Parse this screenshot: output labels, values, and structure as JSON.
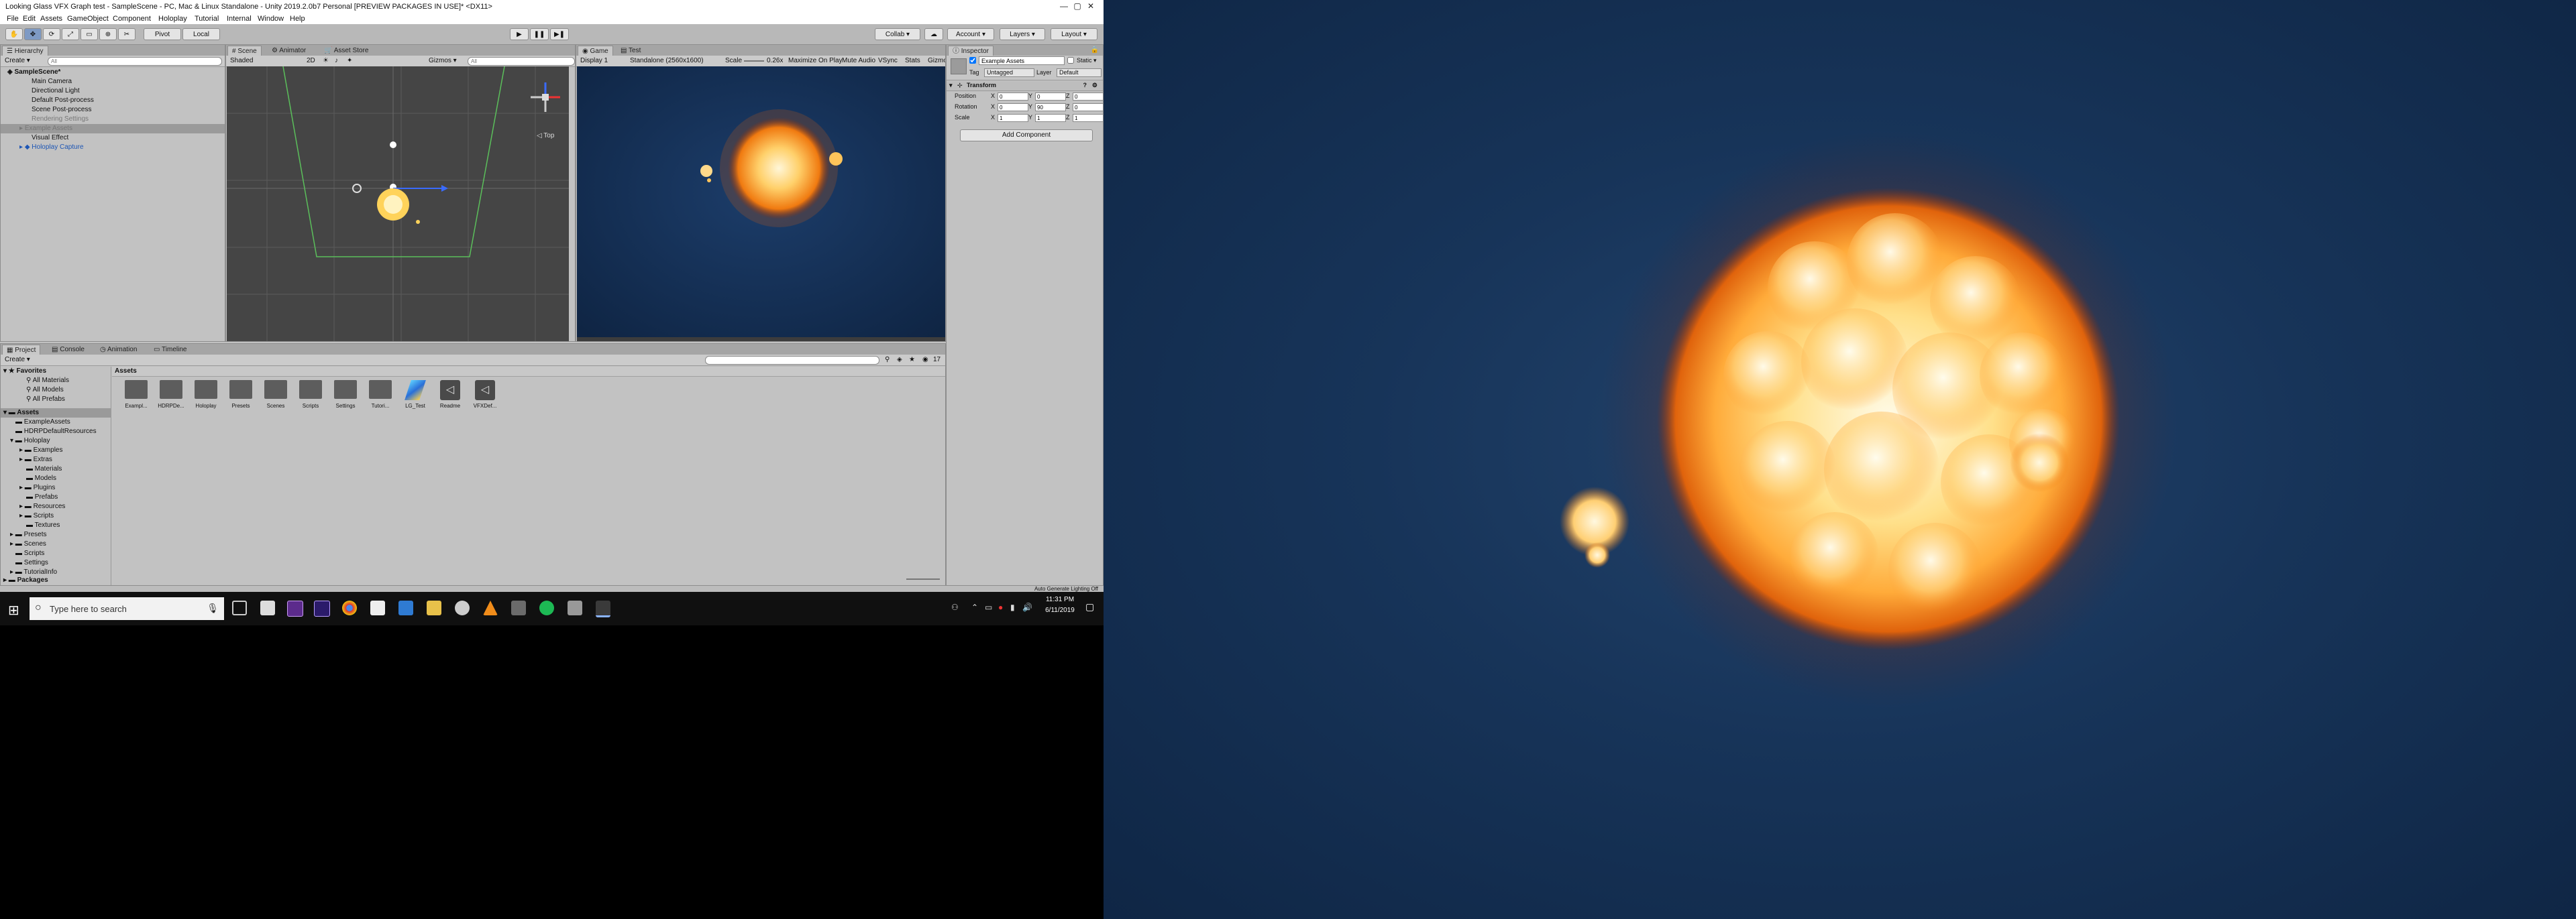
{
  "window": {
    "title": "Looking Glass VFX Graph test - SampleScene - PC, Mac & Linux Standalone - Unity 2019.2.0b7 Personal [PREVIEW PACKAGES IN USE]* <DX11>",
    "minimize": "—",
    "maximize": "▢",
    "close": "✕"
  },
  "menu": [
    "File",
    "Edit",
    "Assets",
    "GameObject",
    "Component",
    "Holoplay",
    "Tutorial",
    "Internal",
    "Window",
    "Help"
  ],
  "toolbar": {
    "pivot": "Pivot",
    "local": "Local",
    "collab": "Collab ▾",
    "account": "Account ▾",
    "layers": "Layers ▾",
    "layout": "Layout ▾"
  },
  "hierarchy": {
    "tab": "Hierarchy",
    "create": "Create ▾",
    "search_placeholder": "All",
    "items": [
      {
        "label": "SampleScene*",
        "indent": 0
      },
      {
        "label": "Main Camera",
        "indent": 2
      },
      {
        "label": "Directional Light",
        "indent": 2
      },
      {
        "label": "Default Post-process",
        "indent": 2
      },
      {
        "label": "Scene Post-process",
        "indent": 2
      },
      {
        "label": "Rendering Settings",
        "indent": 2
      },
      {
        "label": "Example Assets",
        "indent": 1
      },
      {
        "label": "Visual Effect",
        "indent": 2
      },
      {
        "label": "Holoplay Capture",
        "indent": 1
      }
    ]
  },
  "scene": {
    "tabs": [
      "Scene",
      "Animator",
      "Asset Store"
    ],
    "shading": "Shaded",
    "mode": "2D",
    "gizmos": "Gizmos ▾",
    "search_placeholder": "All",
    "orientation": "◁ Top"
  },
  "game": {
    "tabs": [
      "Game",
      "Test"
    ],
    "display": "Display 1",
    "resolution": "Standalone (2560x1600)",
    "scale_label": "Scale",
    "scale_value": "0.26x",
    "options": [
      "Maximize On Play",
      "Mute Audio",
      "VSync",
      "Stats",
      "Gizmos"
    ]
  },
  "inspector": {
    "tab": "Inspector",
    "object_name": "Example Assets",
    "static": "Static ▾",
    "tag_label": "Tag",
    "tag": "Untagged",
    "layer_label": "Layer",
    "layer": "Default",
    "component": "Transform",
    "position": {
      "label": "Position",
      "x": "0",
      "y": "0",
      "z": "0"
    },
    "rotation": {
      "label": "Rotation",
      "x": "0",
      "y": "90",
      "z": "0"
    },
    "scale": {
      "label": "Scale",
      "x": "1",
      "y": "1",
      "z": "1"
    },
    "axis": {
      "x": "X",
      "y": "Y",
      "z": "Z"
    },
    "add_component": "Add Component"
  },
  "project": {
    "tabs": [
      "Project",
      "Console",
      "Animation",
      "Timeline"
    ],
    "create": "Create ▾",
    "favorites": {
      "label": "Favorites",
      "items": [
        "All Materials",
        "All Models",
        "All Prefabs"
      ]
    },
    "assets_root": "Assets",
    "tree": [
      {
        "label": "ExampleAssets",
        "indent": 1
      },
      {
        "label": "HDRPDefaultResources",
        "indent": 1
      },
      {
        "label": "Holoplay",
        "indent": 1
      },
      {
        "label": "Examples",
        "indent": 2
      },
      {
        "label": "Extras",
        "indent": 2
      },
      {
        "label": "Materials",
        "indent": 2
      },
      {
        "label": "Models",
        "indent": 2
      },
      {
        "label": "Plugins",
        "indent": 2
      },
      {
        "label": "Prefabs",
        "indent": 2
      },
      {
        "label": "Resources",
        "indent": 2
      },
      {
        "label": "Scripts",
        "indent": 2
      },
      {
        "label": "Textures",
        "indent": 2
      },
      {
        "label": "Presets",
        "indent": 1
      },
      {
        "label": "Scenes",
        "indent": 1
      },
      {
        "label": "Scripts",
        "indent": 1
      },
      {
        "label": "Settings",
        "indent": 1
      },
      {
        "label": "TutorialInfo",
        "indent": 1
      }
    ],
    "packages": "Packages",
    "breadcrumb": "Assets",
    "assets": [
      {
        "label": "Exampl...",
        "kind": "folder"
      },
      {
        "label": "HDRPDe...",
        "kind": "folder"
      },
      {
        "label": "Holoplay",
        "kind": "folder"
      },
      {
        "label": "Presets",
        "kind": "folder"
      },
      {
        "label": "Scenes",
        "kind": "folder"
      },
      {
        "label": "Scripts",
        "kind": "folder"
      },
      {
        "label": "Settings",
        "kind": "folder"
      },
      {
        "label": "Tutori...",
        "kind": "folder"
      },
      {
        "label": "LG_Test",
        "kind": "vfx"
      },
      {
        "label": "Readme",
        "kind": "unity"
      },
      {
        "label": "VFXDef...",
        "kind": "unity"
      }
    ],
    "count": "17"
  },
  "status": {
    "lighting": "Auto Generate Lighting Off"
  },
  "taskbar": {
    "search_placeholder": "Type here to search",
    "time": "11:31 PM",
    "date": "6/11/2019"
  },
  "colors": {
    "unity_bg": "#c2c2c2",
    "game_bg": "#132d52",
    "scene_bg": "#454545",
    "explosion": "#ffb347",
    "taskbar": "#101010"
  }
}
